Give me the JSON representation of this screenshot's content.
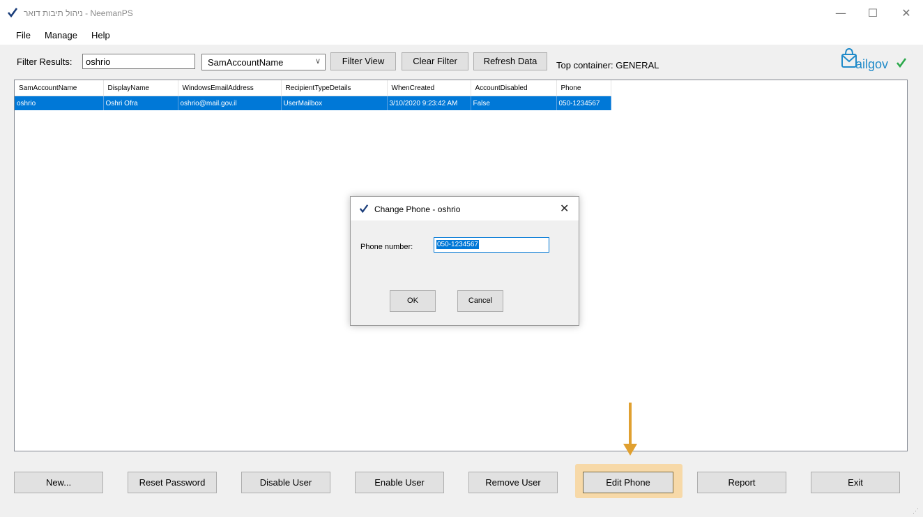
{
  "window": {
    "title": "ניהול תיבות דואר - NeemanPS",
    "minimize": "—",
    "maximize": "☐",
    "close": "✕"
  },
  "menu": {
    "items": [
      "File",
      "Manage",
      "Help"
    ]
  },
  "toolbar": {
    "filter_label": "Filter Results:",
    "filter_value": "oshrio",
    "filter_field": "SamAccountName",
    "filter_view": "Filter View",
    "clear_filter": "Clear Filter",
    "refresh_data": "Refresh Data",
    "top_container": "Top container: GENERAL"
  },
  "logo": {
    "text": "ailgov",
    "accent": "#1f8ac9",
    "check": "#2aa84a"
  },
  "grid": {
    "columns": [
      "SamAccountName",
      "DisplayName",
      "WindowsEmailAddress",
      "RecipientTypeDetails",
      "WhenCreated",
      "AccountDisabled",
      "Phone"
    ],
    "rows": [
      [
        "oshrio",
        "Oshri Ofra",
        "oshrio@mail.gov.il",
        "UserMailbox",
        "3/10/2020 9:23:42 AM",
        "False",
        "050-1234567"
      ]
    ]
  },
  "dialog": {
    "title": "Change Phone - oshrio",
    "close": "✕",
    "phone_label": "Phone number:",
    "phone_value": "050-1234567",
    "ok": "OK",
    "cancel": "Cancel"
  },
  "actions": {
    "new": "New...",
    "reset_password": "Reset Password",
    "disable_user": "Disable User",
    "enable_user": "Enable User",
    "remove_user": "Remove User",
    "edit_phone": "Edit Phone",
    "report": "Report",
    "exit": "Exit"
  },
  "colors": {
    "selection": "#0078d7",
    "highlight": "#f7d9a8",
    "arrow": "#e0a030"
  }
}
